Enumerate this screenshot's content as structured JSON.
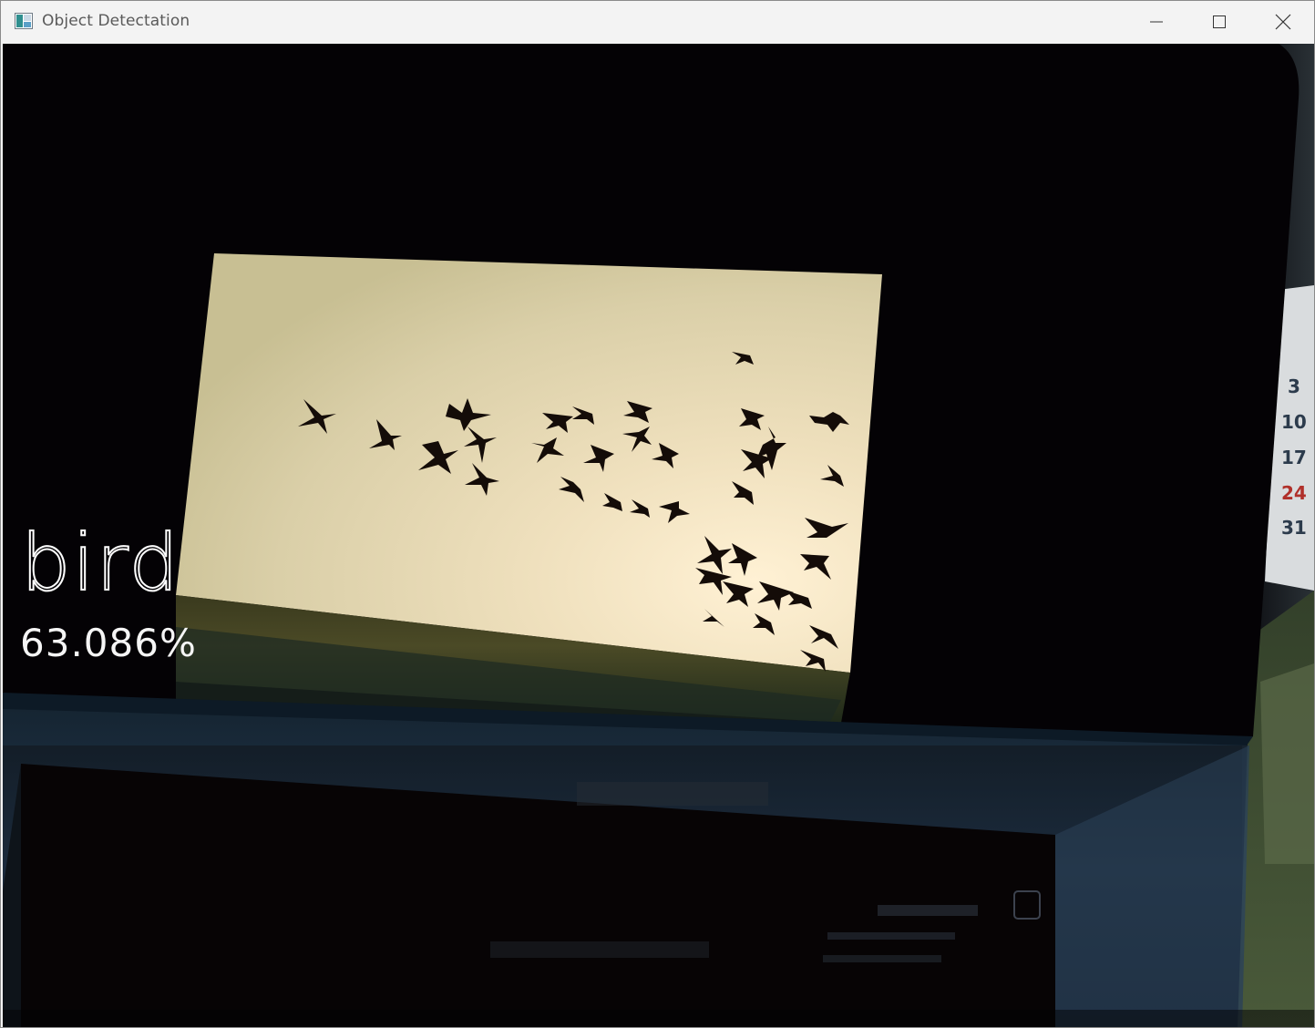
{
  "window": {
    "title": "Object Detectation",
    "icon": "image-window-icon",
    "controls": {
      "minimize_icon": "minimize-icon",
      "maximize_icon": "maximize-icon",
      "close_icon": "close-icon"
    }
  },
  "detection": {
    "label": "bird",
    "confidence": "63.086%",
    "text_color": "#ffffff"
  },
  "calendar_fragment": {
    "numbers": [
      "3",
      "10",
      "17",
      "24",
      "31"
    ],
    "accent_color": "#b0302a"
  },
  "colors": {
    "titlebar": "#f3f3f3",
    "frame_background": "#030102",
    "photo_sky_center": "#f2e6c6"
  }
}
